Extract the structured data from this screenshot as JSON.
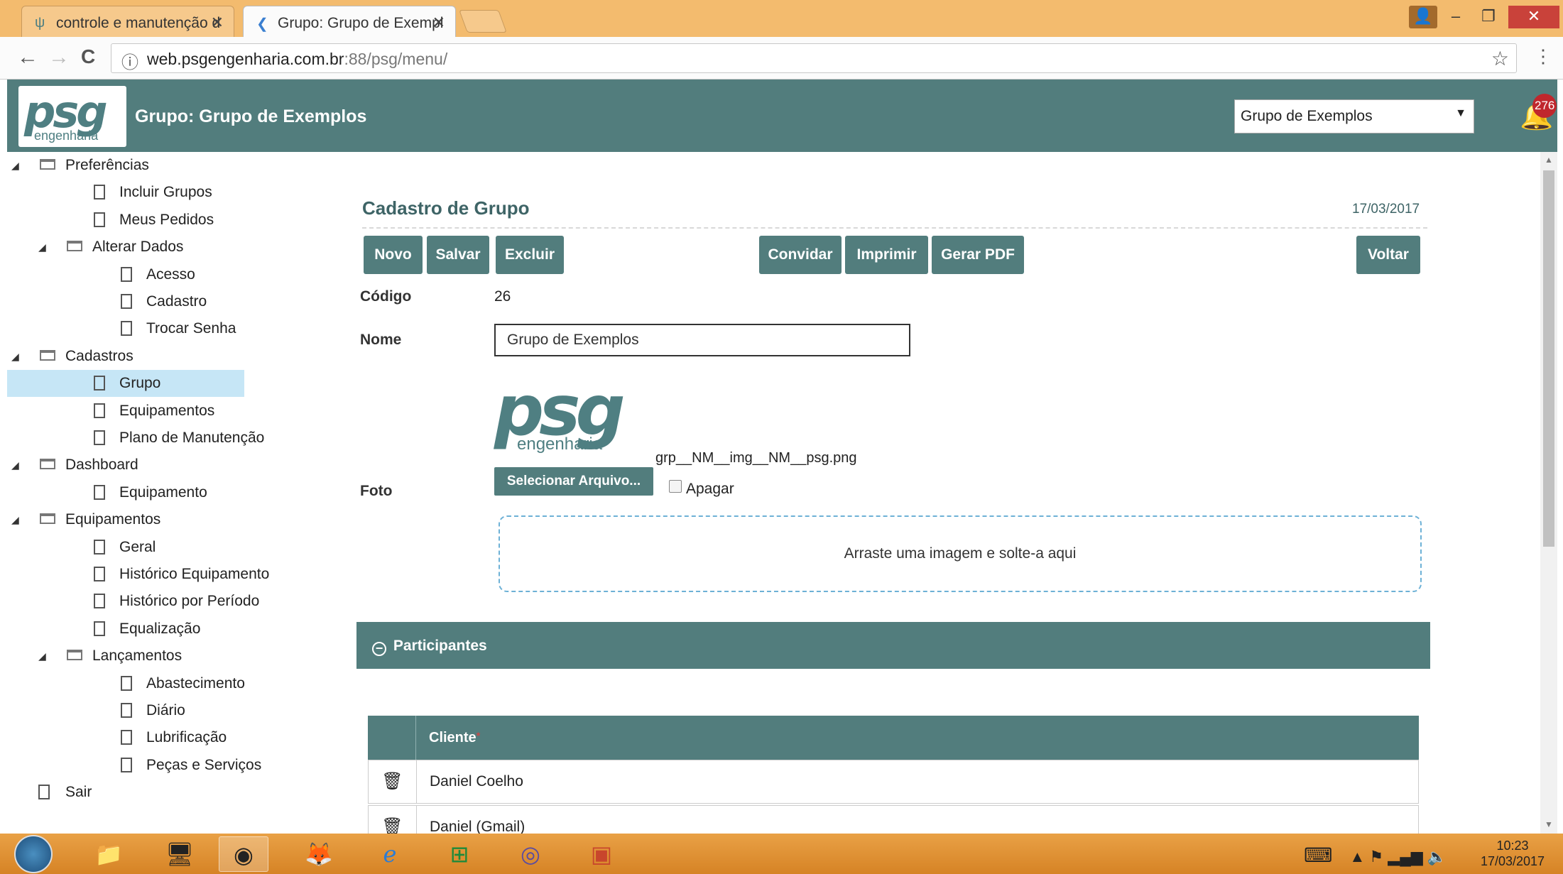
{
  "browser": {
    "tabs": [
      {
        "title": "controle e manutenção d",
        "favicon": "psg-icon",
        "active": false
      },
      {
        "title": "Grupo: Grupo de Exempl",
        "favicon": "app-icon",
        "active": true
      }
    ],
    "url_host": "web.psgengenharia.com.br",
    "url_path": ":88/psg/menu/",
    "close_glyph": "✕",
    "minimize_glyph": "–",
    "restore_glyph": "❐",
    "back_glyph": "←",
    "forward_glyph": "→",
    "reload_glyph": "C",
    "star_glyph": "☆",
    "menu_glyph": "⋮",
    "info_glyph": "ⓘ"
  },
  "header": {
    "logo_text": "psg",
    "logo_sub": "engenharia",
    "title": "Grupo: Grupo de Exemplos",
    "group_select": "Grupo de Exemplos",
    "select_arrow": "▼",
    "notification_count": "276",
    "bell_glyph": "🔔",
    "colors": {
      "bar": "#527d7d",
      "badge": "#c0272d"
    }
  },
  "sidebar": {
    "collapse_glyph": "◢",
    "items": [
      {
        "label": "Preferências",
        "type": "folder",
        "level": 0
      },
      {
        "label": "Incluir Grupos",
        "type": "doc",
        "level": 1
      },
      {
        "label": "Meus Pedidos",
        "type": "doc",
        "level": 1
      },
      {
        "label": "Alterar Dados",
        "type": "folder",
        "level": 1
      },
      {
        "label": "Acesso",
        "type": "doc",
        "level": 2
      },
      {
        "label": "Cadastro",
        "type": "doc",
        "level": 2
      },
      {
        "label": "Trocar Senha",
        "type": "doc",
        "level": 2
      },
      {
        "label": "Cadastros",
        "type": "folder",
        "level": 0
      },
      {
        "label": "Grupo",
        "type": "doc",
        "level": 1,
        "selected": true
      },
      {
        "label": "Equipamentos",
        "type": "doc",
        "level": 1
      },
      {
        "label": "Plano de Manutenção",
        "type": "doc",
        "level": 1
      },
      {
        "label": "Dashboard",
        "type": "folder",
        "level": 0
      },
      {
        "label": "Equipamento",
        "type": "doc",
        "level": 1
      },
      {
        "label": "Equipamentos",
        "type": "folder",
        "level": 0
      },
      {
        "label": "Geral",
        "type": "doc",
        "level": 1
      },
      {
        "label": "Histórico Equipamento",
        "type": "doc",
        "level": 1
      },
      {
        "label": "Histórico por Período",
        "type": "doc",
        "level": 1
      },
      {
        "label": "Equalização",
        "type": "doc",
        "level": 1
      },
      {
        "label": "Lançamentos",
        "type": "folder",
        "level": 1
      },
      {
        "label": "Abastecimento",
        "type": "doc",
        "level": 2
      },
      {
        "label": "Diário",
        "type": "doc",
        "level": 2
      },
      {
        "label": "Lubrificação",
        "type": "doc",
        "level": 2
      },
      {
        "label": "Peças e Serviços",
        "type": "doc",
        "level": 2
      },
      {
        "label": "Sair",
        "type": "doc",
        "level": 0
      }
    ]
  },
  "form": {
    "title": "Cadastro de Grupo",
    "date": "17/03/2017",
    "buttons": {
      "novo": "Novo",
      "salvar": "Salvar",
      "excluir": "Excluir",
      "convidar": "Convidar",
      "imprimir": "Imprimir",
      "gerar_pdf": "Gerar PDF",
      "voltar": "Voltar"
    },
    "codigo_label": "Código",
    "codigo_value": "26",
    "nome_label": "Nome",
    "nome_value": "Grupo de Exemplos",
    "foto_label": "Foto",
    "foto_filename": "grp__NM__img__NM__psg.png",
    "select_file": "Selecionar Arquivo...",
    "apagar_label": "Apagar",
    "dropzone_text": "Arraste uma imagem e solte-a aqui"
  },
  "participantes": {
    "section_title": "Participantes",
    "collapse_glyph": "−",
    "column_header": "Cliente",
    "required_mark": "*",
    "delete_glyph": "🗑",
    "rows": [
      {
        "cliente": "Daniel Coelho"
      },
      {
        "cliente": "Daniel (Gmail)"
      }
    ]
  },
  "taskbar": {
    "icons": [
      "windows-start-icon",
      "file-explorer-icon",
      "remote-desktop-icon",
      "chrome-icon",
      "firefox-icon",
      "internet-explorer-icon",
      "store-icon",
      "app-ring-icon",
      "powerpoint-icon"
    ],
    "keyboard_glyph": "⌨",
    "tray_glyphs": "▲  ⚑  ▂▄▆  🔈",
    "time": "10:23",
    "date": "17/03/2017"
  }
}
